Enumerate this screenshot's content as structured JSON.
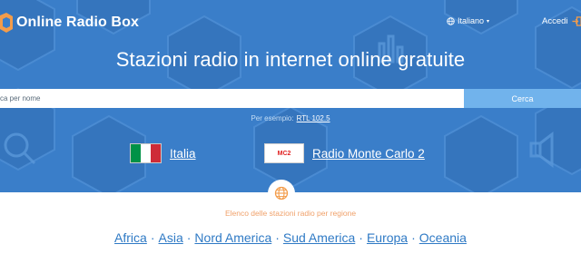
{
  "brand": {
    "name": "Online Radio Box"
  },
  "header": {
    "language": "Italiano",
    "login": "Accedi"
  },
  "hero": {
    "title": "Stazioni radio in internet online gratuite"
  },
  "search": {
    "placeholder": "ca per nome",
    "button": "Cerca"
  },
  "example": {
    "prefix": "Per esempio:",
    "link": "RTL 102.5"
  },
  "country": {
    "name": "Italia",
    "flag_colors": [
      "#009246",
      "#ffffff",
      "#ce2b37"
    ]
  },
  "station": {
    "name": "Radio Monte Carlo 2",
    "logo_text": "MC2"
  },
  "regions": {
    "heading": "Elenco delle stazioni radio per regione",
    "items": [
      "Africa",
      "Asia",
      "Nord America",
      "Sud America",
      "Europa",
      "Oceania"
    ]
  },
  "colors": {
    "hero_bg": "#3a7ec9",
    "button": "#71b3ec",
    "accent": "#f39c4a",
    "link": "#2f7ac5"
  }
}
